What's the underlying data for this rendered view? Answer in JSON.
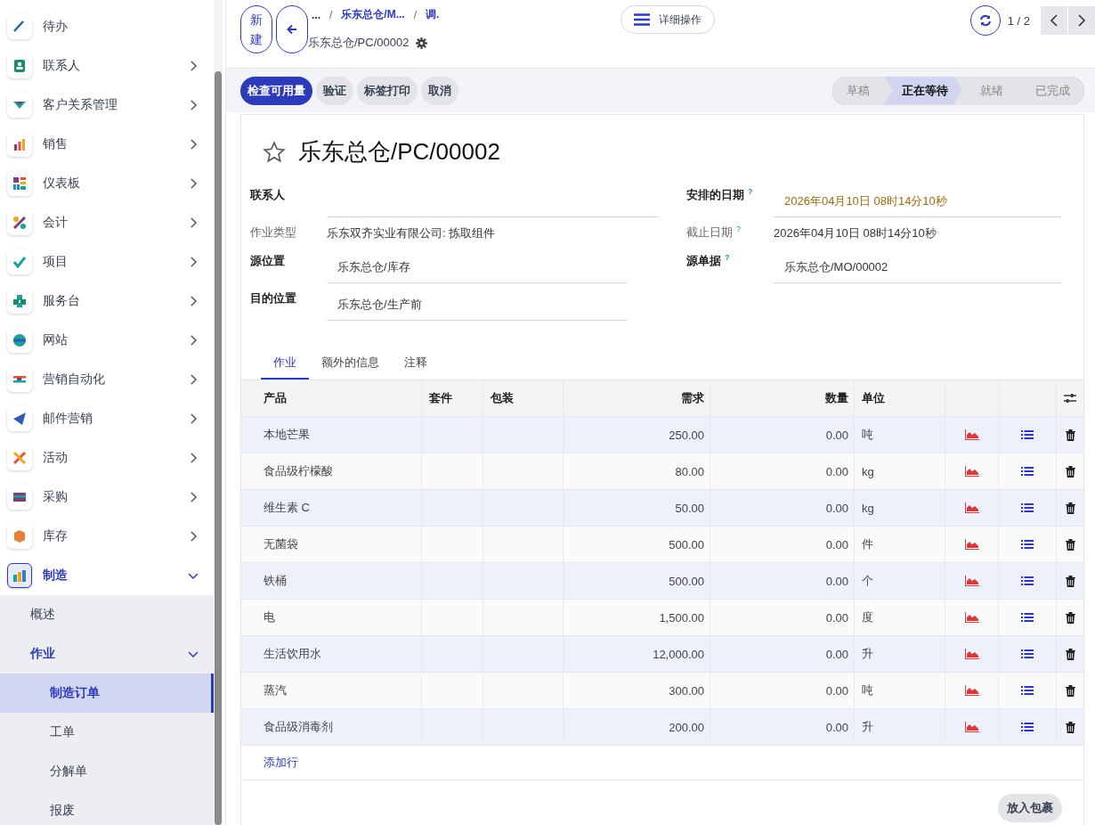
{
  "sidebar": {
    "items": [
      {
        "label": "待办",
        "kind": "link",
        "selected": false
      },
      {
        "label": "联系人",
        "kind": "menu",
        "expanded": false,
        "selected": false
      },
      {
        "label": "客户关系管理",
        "kind": "menu",
        "expanded": false,
        "selected": false
      },
      {
        "label": "销售",
        "kind": "menu",
        "expanded": false,
        "selected": false
      },
      {
        "label": "仪表板",
        "kind": "menu",
        "expanded": false,
        "selected": false
      },
      {
        "label": "会计",
        "kind": "menu",
        "expanded": false,
        "selected": false
      },
      {
        "label": "项目",
        "kind": "menu",
        "expanded": false,
        "selected": false
      },
      {
        "label": "服务台",
        "kind": "menu",
        "expanded": false,
        "selected": false
      },
      {
        "label": "网站",
        "kind": "menu",
        "expanded": false,
        "selected": false
      },
      {
        "label": "营销自动化",
        "kind": "menu",
        "expanded": false,
        "selected": false
      },
      {
        "label": "邮件营销",
        "kind": "menu",
        "expanded": false,
        "selected": false
      },
      {
        "label": "活动",
        "kind": "menu",
        "expanded": false,
        "selected": false
      },
      {
        "label": "采购",
        "kind": "menu",
        "expanded": false,
        "selected": false
      },
      {
        "label": "库存",
        "kind": "menu",
        "expanded": false,
        "selected": false
      },
      {
        "label": "制造",
        "kind": "menu",
        "expanded": true,
        "selected": true,
        "children": [
          {
            "label": "概述",
            "kind": "link",
            "selected": false
          },
          {
            "label": "作业",
            "kind": "menu",
            "expanded": true,
            "selected": true,
            "children": [
              {
                "label": "制造订单",
                "kind": "link",
                "selected": true
              },
              {
                "label": "工单",
                "kind": "link",
                "selected": false
              },
              {
                "label": "分解单",
                "kind": "link",
                "selected": false
              },
              {
                "label": "报废",
                "kind": "link",
                "selected": false
              }
            ]
          }
        ]
      }
    ]
  },
  "header": {
    "new_button": "新建",
    "breadcrumbs": [
      {
        "kind": "link",
        "text": "..."
      },
      {
        "kind": "separator",
        "text": "/"
      },
      {
        "kind": "link",
        "text": "乐东总仓/M..."
      },
      {
        "kind": "separator",
        "text": "/"
      },
      {
        "kind": "link",
        "text": "调."
      }
    ],
    "record_title": "乐东总仓/PC/00002",
    "actions_button": "详细操作",
    "pager": "1 / 2"
  },
  "action_bar": {
    "buttons": [
      {
        "label": "检查可用量",
        "primary": true
      },
      {
        "label": "验证",
        "primary": false
      },
      {
        "label": "标签打印",
        "primary": false
      },
      {
        "label": "取消",
        "primary": false
      }
    ],
    "stages": [
      {
        "label": "草稿",
        "selected": false
      },
      {
        "label": "正在等待",
        "selected": true
      },
      {
        "label": "就绪",
        "selected": false
      },
      {
        "label": "已完成",
        "selected": false
      }
    ]
  },
  "form": {
    "title": "乐东总仓/PC/00002",
    "starred": false,
    "left_fields": [
      {
        "label": "联系人",
        "kind": "input"
      },
      {
        "label": "作业类型",
        "kind": "readonly",
        "value": "乐东双齐实业有限公司: 拣取组件"
      },
      {
        "label": "源位置",
        "kind": "input",
        "value": "乐东总仓/库存"
      },
      {
        "label": "目的位置",
        "kind": "input",
        "value": "乐东总仓/生产前"
      }
    ],
    "right_fields": [
      {
        "label": "安排的日期",
        "help": "?",
        "kind": "input",
        "warning": true,
        "value": "2026年04月10日 08时14分10秒"
      },
      {
        "label": "截止日期",
        "help": "?",
        "kind": "readonly",
        "warning": false,
        "value": "2026年04月10日 08时14分10秒"
      },
      {
        "label": "源单据",
        "help": "?",
        "kind": "input",
        "warning": false,
        "value": "乐东总仓/MO/00002"
      }
    ],
    "tabs": [
      {
        "label": "作业",
        "selected": true
      },
      {
        "label": "额外的信息",
        "selected": false
      },
      {
        "label": "注释",
        "selected": false
      }
    ]
  },
  "table": {
    "columns": [
      "产品",
      "套件",
      "包装",
      "需求",
      "数量",
      "单位"
    ],
    "rows": [
      {
        "product": "本地芒果",
        "demand": "250.00",
        "quantity": "0.00",
        "unit": "吨"
      },
      {
        "product": "食品级柠檬酸",
        "demand": "80.00",
        "quantity": "0.00",
        "unit": "kg"
      },
      {
        "product": "维生素 C",
        "demand": "50.00",
        "quantity": "0.00",
        "unit": "kg"
      },
      {
        "product": "无菌袋",
        "demand": "500.00",
        "quantity": "0.00",
        "unit": "件"
      },
      {
        "product": "铁桶",
        "demand": "500.00",
        "quantity": "0.00",
        "unit": "个"
      },
      {
        "product": "电",
        "demand": "1,500.00",
        "quantity": "0.00",
        "unit": "度"
      },
      {
        "product": "生活饮用水",
        "demand": "12,000.00",
        "quantity": "0.00",
        "unit": "升"
      },
      {
        "product": "蒸汽",
        "demand": "300.00",
        "quantity": "0.00",
        "unit": "吨"
      },
      {
        "product": "食品级消毒剂",
        "demand": "200.00",
        "quantity": "0.00",
        "unit": "升"
      }
    ],
    "add_line": "添加行"
  },
  "package_button": "放入包裹"
}
